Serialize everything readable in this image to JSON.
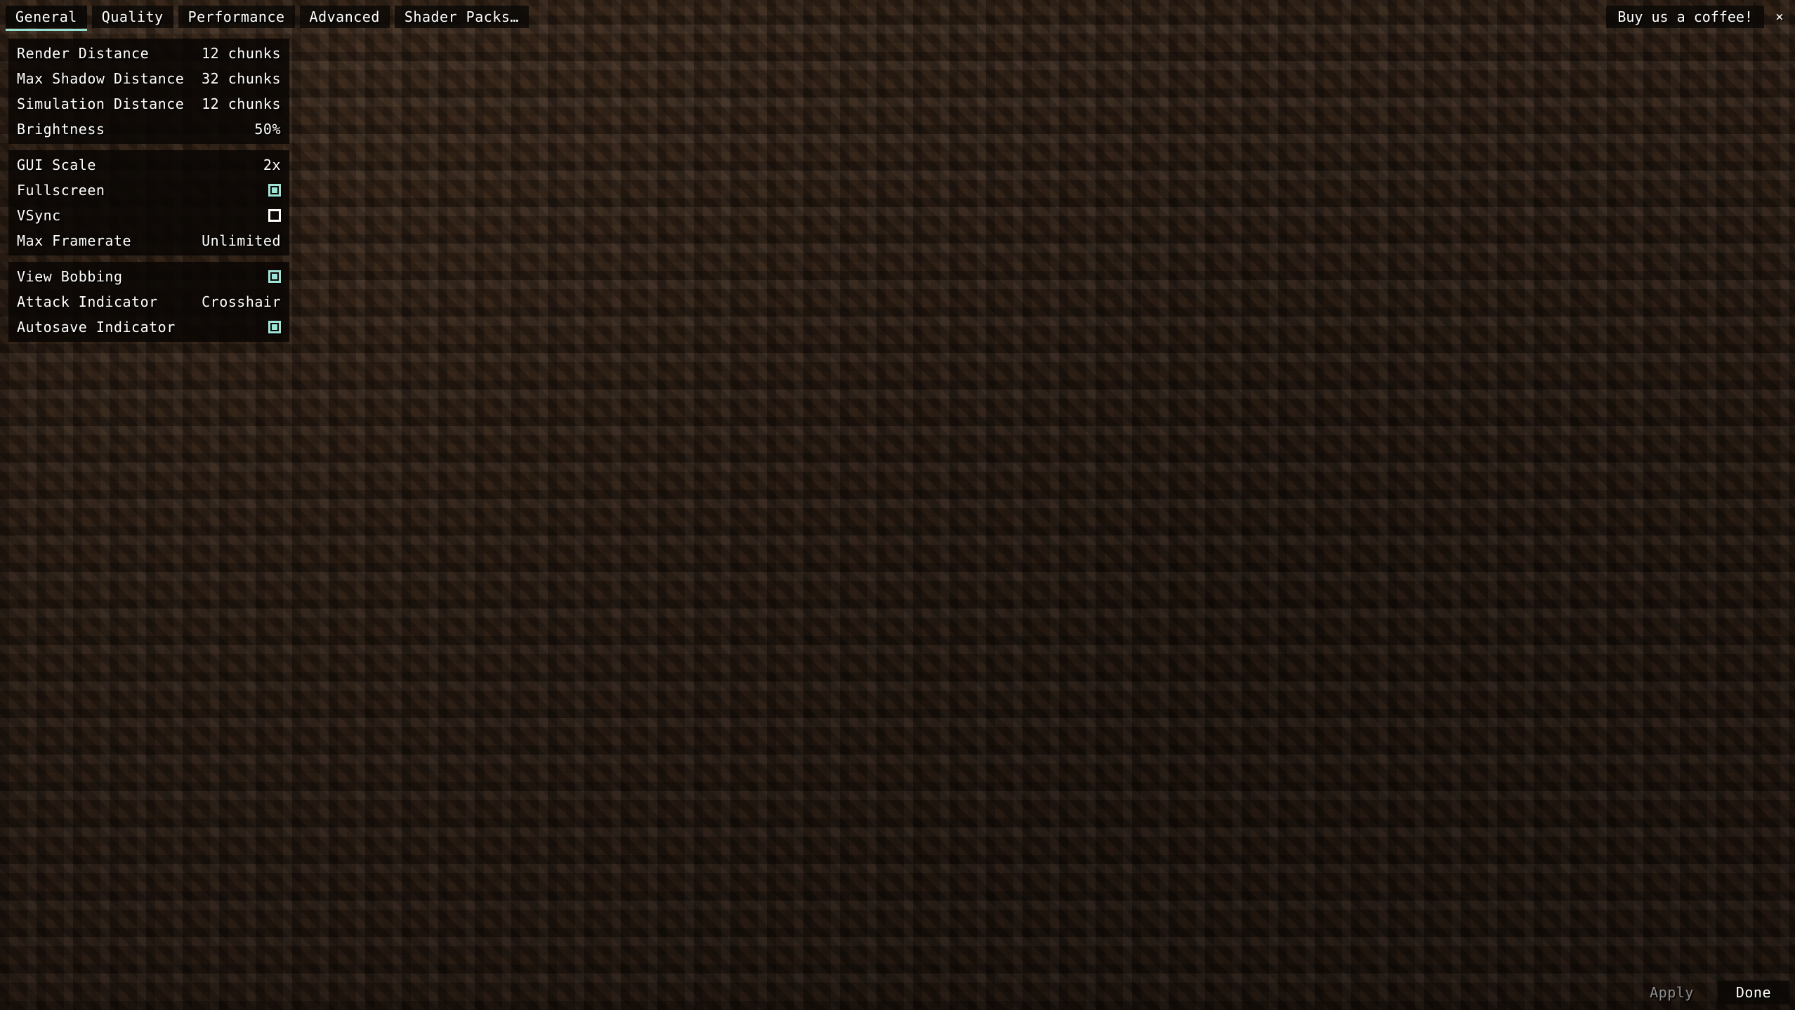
{
  "theme": {
    "accent": "#94dfd0",
    "text": "#ffffff",
    "disabled_text": "#8d8d8d",
    "panel_bg": "#090604",
    "background": "#33241a"
  },
  "tabs": [
    {
      "label": "General",
      "active": true
    },
    {
      "label": "Quality",
      "active": false
    },
    {
      "label": "Performance",
      "active": false
    },
    {
      "label": "Advanced",
      "active": false
    },
    {
      "label": "Shader Packs…",
      "active": false
    }
  ],
  "topbar": {
    "coffee_label": "Buy us a coffee!",
    "close_icon": "×"
  },
  "settings": {
    "groups": [
      {
        "rows": [
          {
            "label": "Render Distance",
            "type": "value",
            "value": "12 chunks"
          },
          {
            "label": "Max Shadow Distance",
            "type": "value",
            "value": "32 chunks"
          },
          {
            "label": "Simulation Distance",
            "type": "value",
            "value": "12 chunks"
          },
          {
            "label": "Brightness",
            "type": "value",
            "value": "50%"
          }
        ]
      },
      {
        "rows": [
          {
            "label": "GUI Scale",
            "type": "value",
            "value": "2x"
          },
          {
            "label": "Fullscreen",
            "type": "checkbox",
            "checked": true
          },
          {
            "label": "VSync",
            "type": "checkbox",
            "checked": false
          },
          {
            "label": "Max Framerate",
            "type": "value",
            "value": "Unlimited"
          }
        ]
      },
      {
        "rows": [
          {
            "label": "View Bobbing",
            "type": "checkbox",
            "checked": true
          },
          {
            "label": "Attack Indicator",
            "type": "value",
            "value": "Crosshair"
          },
          {
            "label": "Autosave Indicator",
            "type": "checkbox",
            "checked": true
          }
        ]
      }
    ]
  },
  "footer": {
    "apply_label": "Apply",
    "apply_enabled": false,
    "done_label": "Done",
    "done_enabled": true
  }
}
